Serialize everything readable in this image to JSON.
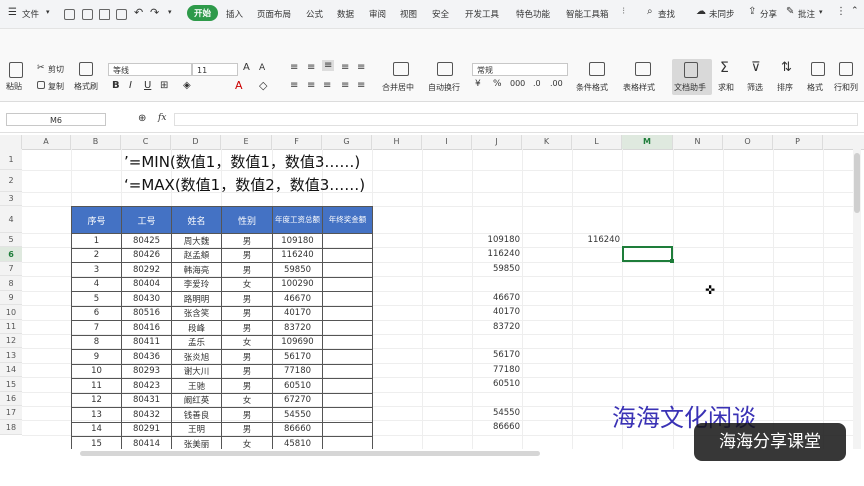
{
  "menubar": {
    "file": "文件",
    "tabs": [
      "开始",
      "插入",
      "页面布局",
      "公式",
      "数据",
      "审阅",
      "视图",
      "安全",
      "开发工具",
      "特色功能",
      "智能工具箱"
    ],
    "search": "查找",
    "sync": "未同步",
    "share": "分享",
    "comment": "批注"
  },
  "ribbon": {
    "paste": "粘贴",
    "cut": "剪切",
    "copy": "复制",
    "format_painter": "格式刷",
    "font_name": "等线",
    "font_size": "11",
    "number_format": "常规",
    "merge_center": "合并居中",
    "wrap_text": "自动换行",
    "cond_format": "条件格式",
    "table_style": "表格样式",
    "doc_assist": "文档助手",
    "sum": "求和",
    "filter": "筛选",
    "sort": "排序",
    "format": "格式",
    "rows_cols": "行和列"
  },
  "formula_bar": {
    "name_box": "M6",
    "fx": "fx",
    "content": ""
  },
  "columns": [
    "A",
    "B",
    "C",
    "D",
    "E",
    "F",
    "G",
    "H",
    "I",
    "J",
    "K",
    "L",
    "M",
    "N",
    "O",
    "P"
  ],
  "rows": [
    "1",
    "2",
    "3",
    "4",
    "5",
    "6",
    "7",
    "8",
    "9",
    "10",
    "11",
    "12",
    "13",
    "14",
    "15",
    "16",
    "17",
    "18"
  ],
  "formulas": {
    "line1": "’=MIN(数值1，数值1，数值3……)",
    "line2": "‘=MAX(数值1，数值2，数值3……)"
  },
  "table": {
    "headers": [
      "序号",
      "工号",
      "姓名",
      "性别",
      "年度工资总额",
      "年终奖金额"
    ],
    "rows": [
      [
        "1",
        "80425",
        "周大魏",
        "男",
        "109180",
        ""
      ],
      [
        "2",
        "80426",
        "赵孟頫",
        "男",
        "116240",
        ""
      ],
      [
        "3",
        "80292",
        "韩海亮",
        "男",
        "59850",
        ""
      ],
      [
        "4",
        "80404",
        "李爱玲",
        "女",
        "100290",
        ""
      ],
      [
        "5",
        "80430",
        "路明明",
        "男",
        "46670",
        ""
      ],
      [
        "6",
        "80516",
        "张含笑",
        "男",
        "40170",
        ""
      ],
      [
        "7",
        "80416",
        "段峰",
        "男",
        "83720",
        ""
      ],
      [
        "8",
        "80411",
        "孟乐",
        "女",
        "109690",
        ""
      ],
      [
        "9",
        "80436",
        "张炎旭",
        "男",
        "56170",
        ""
      ],
      [
        "10",
        "80293",
        "谢大川",
        "男",
        "77180",
        ""
      ],
      [
        "11",
        "80423",
        "王驰",
        "男",
        "60510",
        ""
      ],
      [
        "12",
        "80431",
        "阚红英",
        "女",
        "67270",
        ""
      ],
      [
        "13",
        "80432",
        "钱善良",
        "男",
        "54550",
        ""
      ],
      [
        "14",
        "80291",
        "王明",
        "男",
        "86660",
        ""
      ],
      [
        "15",
        "80414",
        "张美丽",
        "女",
        "45810",
        ""
      ]
    ]
  },
  "col_j_values": [
    {
      "row": 5,
      "value": "109180"
    },
    {
      "row": 6,
      "value": "116240"
    },
    {
      "row": 7,
      "value": "59850"
    },
    {
      "row": 9,
      "value": "46670"
    },
    {
      "row": 10,
      "value": "40170"
    },
    {
      "row": 11,
      "value": "83720"
    },
    {
      "row": 13,
      "value": "56170"
    },
    {
      "row": 14,
      "value": "77180"
    },
    {
      "row": 15,
      "value": "60510"
    },
    {
      "row": 17,
      "value": "54550"
    },
    {
      "row": 18,
      "value": "86660"
    }
  ],
  "col_l_value": {
    "row": 5,
    "value": "116240"
  },
  "selected_cell": "M6",
  "watermark": "海海文化闲谈",
  "badge": "海海分享课堂",
  "colors": {
    "accent_green": "#2e9a4a",
    "header_blue": "#4472c4",
    "watermark_purple": "#3a32b5",
    "selection_green": "#1e7d3a"
  }
}
